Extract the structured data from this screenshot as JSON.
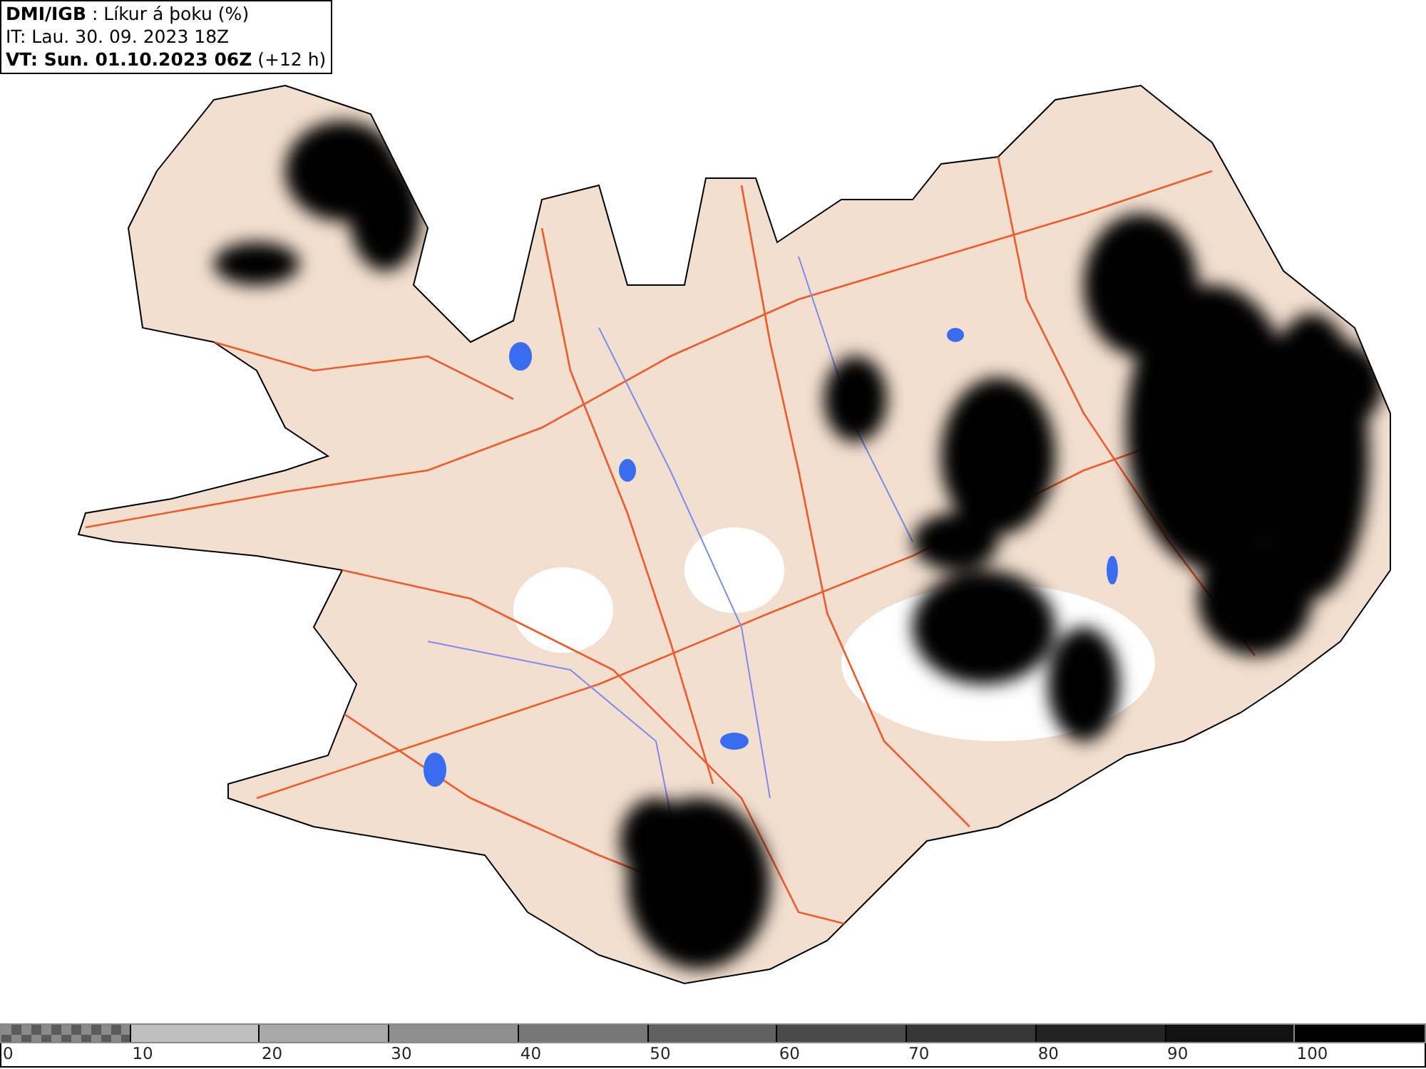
{
  "header": {
    "lines": [
      "**DMI/IGB** : Líkur á þoku (%)",
      "IT: Lau. 30. 09. 2023 18Z",
      "**VT: Sun. 01.10.2023 06Z** (+12 h)"
    ]
  },
  "legend": {
    "bins": [
      {
        "kind": "checker",
        "color": "#5a5a5a"
      },
      {
        "kind": "solid",
        "color": "#bfbfbf"
      },
      {
        "kind": "solid",
        "color": "#a8a8a8"
      },
      {
        "kind": "solid",
        "color": "#8f8f8f"
      },
      {
        "kind": "solid",
        "color": "#777777"
      },
      {
        "kind": "solid",
        "color": "#606060"
      },
      {
        "kind": "solid",
        "color": "#4a4a4a"
      },
      {
        "kind": "solid",
        "color": "#363636"
      },
      {
        "kind": "solid",
        "color": "#232323"
      },
      {
        "kind": "solid",
        "color": "#121212"
      },
      {
        "kind": "solid",
        "color": "#000000"
      }
    ],
    "ticks": [
      "0",
      "10",
      "20",
      "30",
      "40",
      "50",
      "60",
      "70",
      "80",
      "90",
      "100"
    ]
  }
}
